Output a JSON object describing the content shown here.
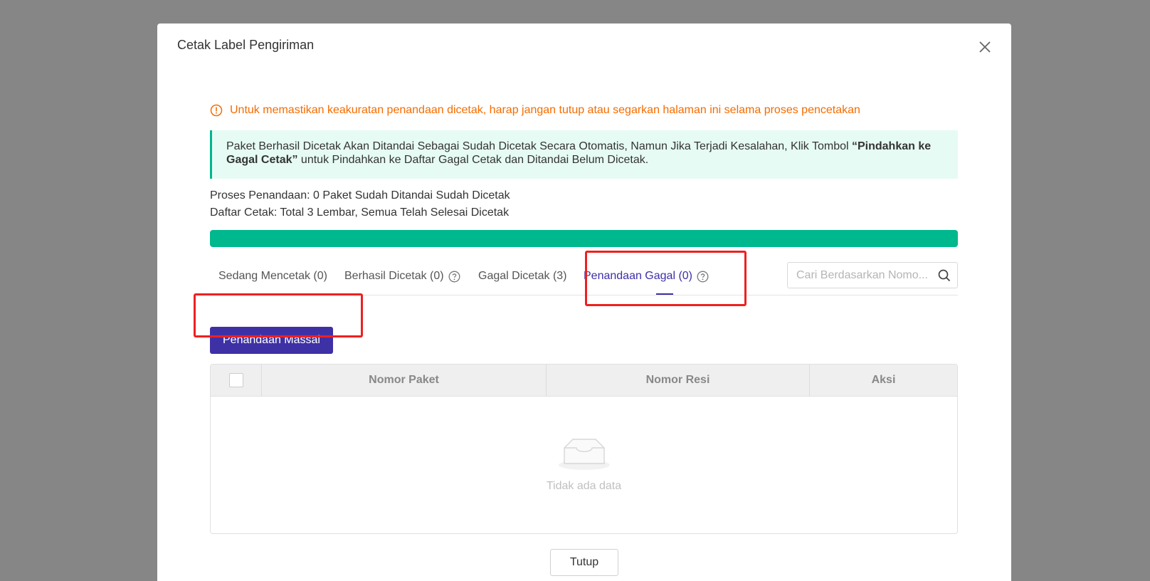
{
  "modal": {
    "title": "Cetak Label Pengiriman"
  },
  "warning": {
    "text": "Untuk memastikan keakuratan penandaan dicetak, harap jangan tutup atau segarkan halaman ini selama proses pencetakan"
  },
  "info": {
    "text_before": "Paket Berhasil Dicetak Akan Ditandai Sebagai Sudah Dicetak Secara Otomatis, Namun Jika Terjadi Kesalahan, Klik Tombol ",
    "text_bold": "“Pindahkan ke Gagal Cetak”",
    "text_after": " untuk Pindahkan ke Daftar Gagal Cetak dan Ditandai Belum Dicetak."
  },
  "status": {
    "marking_process": "Proses Penandaan: 0 Paket Sudah Ditandai Sudah Dicetak",
    "print_list": "Daftar Cetak: Total 3 Lembar, Semua Telah Selesai Dicetak",
    "progress_percent": 100
  },
  "tabs": [
    {
      "label": "Sedang Mencetak (0)",
      "active": false
    },
    {
      "label": "Berhasil Dicetak (0)",
      "active": false
    },
    {
      "label": "Gagal Dicetak (3)",
      "active": false
    },
    {
      "label": "Penandaan Gagal (0)",
      "active": true
    }
  ],
  "search": {
    "placeholder": "Cari Berdasarkan Nomo..."
  },
  "toolbar": {
    "mass_mark_label": "Penandaan Massal"
  },
  "table": {
    "columns": [
      "Nomor Paket",
      "Nomor Resi",
      "Aksi"
    ],
    "empty_text": "Tidak ada data"
  },
  "footer": {
    "close_label": "Tutup"
  },
  "colors": {
    "accent": "#3e31a6",
    "success": "#00b88e",
    "warning": "#f56c00",
    "highlight": "#ee2020"
  }
}
